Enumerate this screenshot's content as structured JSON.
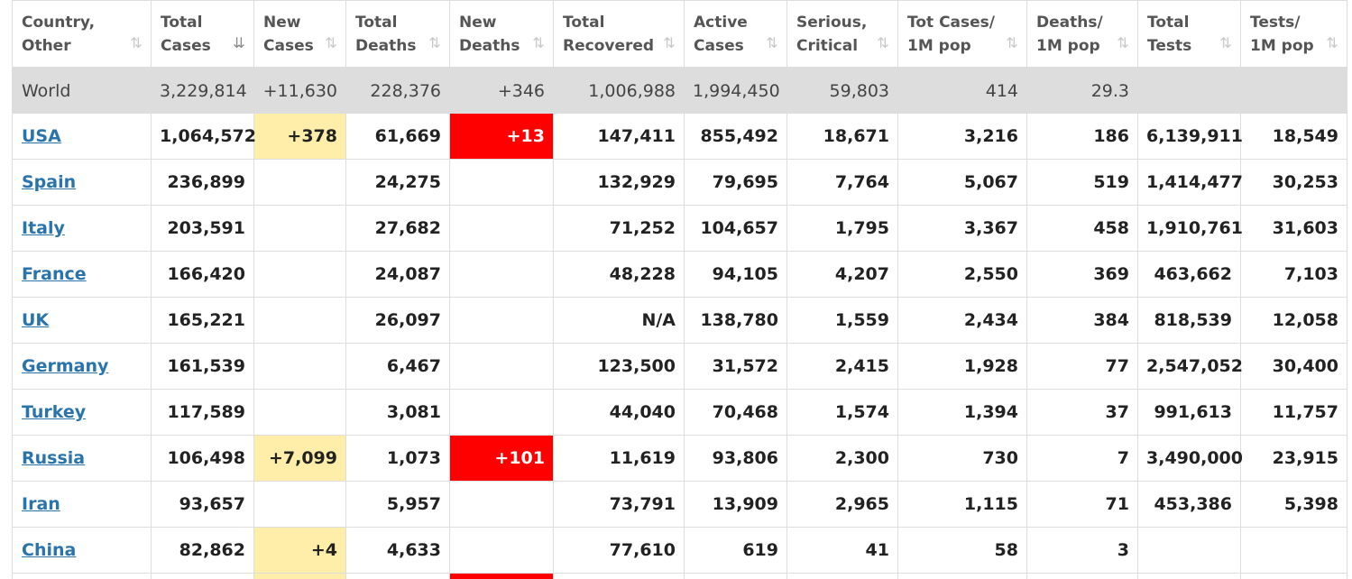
{
  "headers": [
    {
      "line1": "Country,",
      "line2": "Other",
      "sort_active": false
    },
    {
      "line1": "Total",
      "line2": "Cases",
      "sort_active": true
    },
    {
      "line1": "New",
      "line2": "Cases",
      "sort_active": false
    },
    {
      "line1": "Total",
      "line2": "Deaths",
      "sort_active": false
    },
    {
      "line1": "New",
      "line2": "Deaths",
      "sort_active": false
    },
    {
      "line1": "Total",
      "line2": "Recovered",
      "sort_active": false
    },
    {
      "line1": "Active",
      "line2": "Cases",
      "sort_active": false
    },
    {
      "line1": "Serious,",
      "line2": "Critical",
      "sort_active": false
    },
    {
      "line1": "Tot Cases/",
      "line2": "1M pop",
      "sort_active": false
    },
    {
      "line1": "Deaths/",
      "line2": "1M pop",
      "sort_active": false
    },
    {
      "line1": "Total",
      "line2": "Tests",
      "sort_active": false
    },
    {
      "line1": "Tests/",
      "line2": "1M pop",
      "sort_active": false
    }
  ],
  "icons": {
    "sort": "sort-arrows-icon",
    "sort_active": "sort-descending-icon"
  },
  "colors": {
    "new_cases_bg": "#ffeeaa",
    "new_deaths_bg": "#ff0000",
    "world_bg": "#dddddd",
    "link": "#2a74ad"
  },
  "world": [
    "World",
    "3,229,814",
    "+11,630",
    "228,376",
    "+346",
    "1,006,988",
    "1,994,450",
    "59,803",
    "414",
    "29.3",
    "",
    ""
  ],
  "rows": [
    [
      "USA",
      "1,064,572",
      "+378",
      "61,669",
      "+13",
      "147,411",
      "855,492",
      "18,671",
      "3,216",
      "186",
      "6,139,911",
      "18,549"
    ],
    [
      "Spain",
      "236,899",
      "",
      "24,275",
      "",
      "132,929",
      "79,695",
      "7,764",
      "5,067",
      "519",
      "1,414,477",
      "30,253"
    ],
    [
      "Italy",
      "203,591",
      "",
      "27,682",
      "",
      "71,252",
      "104,657",
      "1,795",
      "3,367",
      "458",
      "1,910,761",
      "31,603"
    ],
    [
      "France",
      "166,420",
      "",
      "24,087",
      "",
      "48,228",
      "94,105",
      "4,207",
      "2,550",
      "369",
      "463,662",
      "7,103"
    ],
    [
      "UK",
      "165,221",
      "",
      "26,097",
      "",
      "N/A",
      "138,780",
      "1,559",
      "2,434",
      "384",
      "818,539",
      "12,058"
    ],
    [
      "Germany",
      "161,539",
      "",
      "6,467",
      "",
      "123,500",
      "31,572",
      "2,415",
      "1,928",
      "77",
      "2,547,052",
      "30,400"
    ],
    [
      "Turkey",
      "117,589",
      "",
      "3,081",
      "",
      "44,040",
      "70,468",
      "1,574",
      "1,394",
      "37",
      "991,613",
      "11,757"
    ],
    [
      "Russia",
      "106,498",
      "+7,099",
      "1,073",
      "+101",
      "11,619",
      "93,806",
      "2,300",
      "730",
      "7",
      "3,490,000",
      "23,915"
    ],
    [
      "Iran",
      "93,657",
      "",
      "5,957",
      "",
      "73,791",
      "13,909",
      "2,965",
      "1,115",
      "71",
      "453,386",
      "5,398"
    ],
    [
      "China",
      "82,862",
      "+4",
      "4,633",
      "",
      "77,610",
      "619",
      "41",
      "58",
      "3",
      "",
      ""
    ]
  ],
  "cut_row": {
    "new_cases_highlight": true,
    "new_deaths_highlight": true
  }
}
